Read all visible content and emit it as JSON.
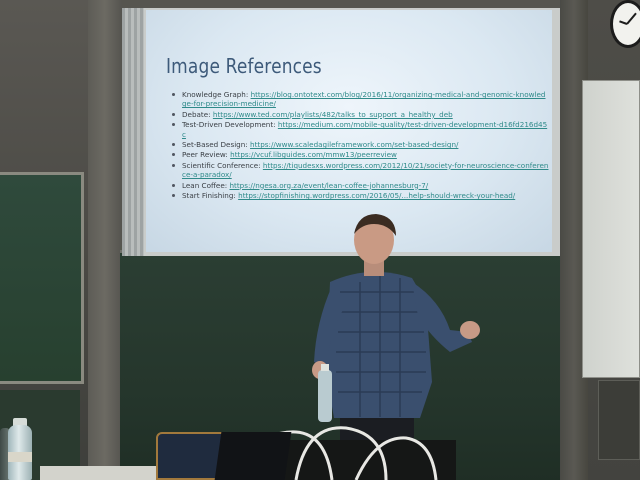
{
  "slide": {
    "title": "Image References",
    "references": [
      {
        "label": "Knowledge Graph:",
        "link": "https://blog.ontotext.com/blog/2016/11/organizing-medical-and-genomic-knowledge-for-precision-medicine/"
      },
      {
        "label": "Debate:",
        "link": "https://www.ted.com/playlists/482/talks_to_support_a_healthy_deb"
      },
      {
        "label": "Test-Driven Development:",
        "link": "https://medium.com/mobile-quality/test-driven-development-d16fd216d45c"
      },
      {
        "label": "Set-Based Design:",
        "link": "https://www.scaledagileframework.com/set-based-design/"
      },
      {
        "label": "Peer Review:",
        "link": "https://vcuf.libguides.com/mmw13/peerreview"
      },
      {
        "label": "Scientific Conference:",
        "link": "https://tiqudesxs.wordpress.com/2012/10/21/society-for-neuroscience-conference-a-paradox/"
      },
      {
        "label": "Lean Coffee:",
        "link": "https://ngesa.org.za/event/lean-coffee-johannesburg-7/"
      },
      {
        "label": "Start Finishing:",
        "link": "https://stopfinishing.wordpress.com/2016/05/...help-should-wreck-your-head/"
      }
    ]
  },
  "colors": {
    "slide_background": "#dbe8f2",
    "title_color": "#3d5a7a",
    "link_color": "#2f8a8a",
    "chalkboard": "#27402f"
  }
}
